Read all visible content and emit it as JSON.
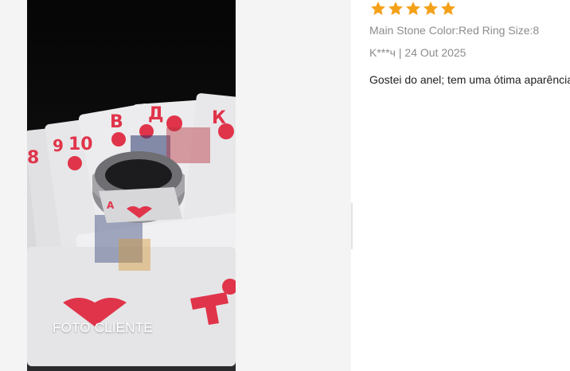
{
  "review": {
    "rating": 5,
    "max_rating": 5,
    "star_color": "#f4a11a",
    "attributes": "Main Stone Color:Red Ring Size:8",
    "author": "K***ч",
    "separator": " | ",
    "date": "24 Out 2025",
    "text": "Gostei do anel; tem uma ótima aparência."
  },
  "photo": {
    "caption": "FOTO CLIENTE"
  },
  "colors": {
    "gallery_bg": "#f4f4f4",
    "meta_text": "#8c8c8c",
    "body_text": "#222222",
    "card_red": "#e0344a"
  }
}
